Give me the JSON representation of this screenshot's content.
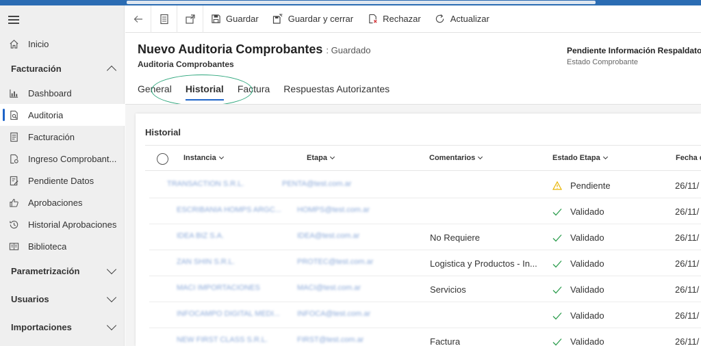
{
  "sidebar": {
    "home": "Inicio",
    "sections": {
      "facturacion": "Facturación",
      "parametrizacion": "Parametrización",
      "usuarios": "Usuarios",
      "importaciones": "Importaciones"
    },
    "items": [
      {
        "label": "Dashboard",
        "icon": "bar-chart-icon"
      },
      {
        "label": "Auditoria",
        "icon": "document-search-icon"
      },
      {
        "label": "Facturación",
        "icon": "document-icon"
      },
      {
        "label": "Ingreso Comprobant...",
        "icon": "document-settings-icon"
      },
      {
        "label": "Pendiente Datos",
        "icon": "document-edit-icon"
      },
      {
        "label": "Aprobaciones",
        "icon": "thumbs-up-icon"
      },
      {
        "label": "Historial Aprobaciones",
        "icon": "history-icon"
      },
      {
        "label": "Biblioteca",
        "icon": "library-icon"
      }
    ]
  },
  "toolbar": {
    "save": "Guardar",
    "save_close": "Guardar y cerrar",
    "reject": "Rechazar",
    "refresh": "Actualizar"
  },
  "header": {
    "title": "Nuevo Auditoria Comprobantes",
    "status": ": Guardado",
    "entity": "Auditoria Comprobantes",
    "field_value": "Pendiente Información Respaldator",
    "field_label": "Estado Comprobante"
  },
  "tabs": [
    "General",
    "Historial",
    "Factura",
    "Respuestas Autorizantes"
  ],
  "grid": {
    "title": "Historial",
    "columns": [
      "Instancia",
      "Etapa",
      "Comentarios",
      "Estado Etapa",
      "Fecha d"
    ],
    "rows": [
      {
        "instancia": "TRANSACTION S.R.L.",
        "etapa": "PENTA@test.com.ar",
        "comentarios": "",
        "estado": "Pendiente",
        "fecha": "26/11/"
      },
      {
        "instancia": "ESCRIBANIA HOMPS ARGC...",
        "etapa": "HOMPS@test.com.ar",
        "comentarios": "",
        "estado": "Validado",
        "fecha": "26/11/"
      },
      {
        "instancia": "IDEA BIZ S.A.",
        "etapa": "IDEA@test.com.ar",
        "comentarios": "No Requiere",
        "estado": "Validado",
        "fecha": "26/11/"
      },
      {
        "instancia": "ZAN SHIN S.R.L.",
        "etapa": "PROTEC@test.com.ar",
        "comentarios": "Logistica y Productos - In...",
        "estado": "Validado",
        "fecha": "26/11/"
      },
      {
        "instancia": "MACI IMPORTACIONES",
        "etapa": "MACI@test.com.ar",
        "comentarios": "Servicios",
        "estado": "Validado",
        "fecha": "26/11/"
      },
      {
        "instancia": "INFOCAMPO DIGITAL MEDI...",
        "etapa": "INFOCA@test.com.ar",
        "comentarios": "",
        "estado": "Validado",
        "fecha": "26/11/"
      },
      {
        "instancia": "NEW FIRST CLASS S.R.L.",
        "etapa": "FIRST@test.com.ar",
        "comentarios": "Factura",
        "estado": "Validado",
        "fecha": "26/11/"
      }
    ]
  },
  "colors": {
    "accent": "#1e64c8",
    "topbar": "#2b6cb3",
    "annotation": "#2aa57a",
    "warning": "#e8b400",
    "success": "#2e9e4f"
  }
}
